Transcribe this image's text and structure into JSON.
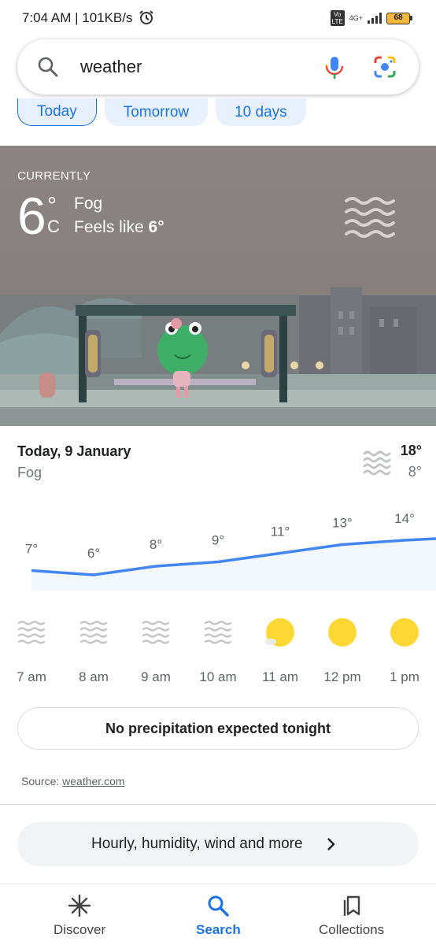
{
  "status_bar": {
    "time": "7:04 AM | 101KB/s",
    "network": "4G+",
    "battery": "68"
  },
  "search": {
    "query": "weather"
  },
  "tabs": [
    {
      "label": "Today",
      "active": true
    },
    {
      "label": "Tomorrow",
      "active": false
    },
    {
      "label": "10 days",
      "active": false
    }
  ],
  "current": {
    "heading": "CURRENTLY",
    "temp": "6",
    "deg": "°",
    "unit": "C",
    "condition": "Fog",
    "feels_like_label": "Feels like",
    "feels_like_value": "6°"
  },
  "today": {
    "date": "Today, 9 January",
    "condition": "Fog",
    "high": "18°",
    "low": "8°"
  },
  "hourly": {
    "times": [
      "7 am",
      "8 am",
      "9 am",
      "10 am",
      "11 am",
      "12 pm",
      "1 pm"
    ],
    "temps": [
      7,
      6,
      8,
      9,
      11,
      13,
      14
    ],
    "temp_labels": [
      "7°",
      "6°",
      "8°",
      "9°",
      "11°",
      "13°",
      "14°"
    ],
    "icons": [
      "fog-icon",
      "fog-icon",
      "fog-icon",
      "fog-icon",
      "partly-sunny-icon",
      "sunny-icon",
      "sunny-icon"
    ]
  },
  "notice": "No precipitation expected tonight",
  "source": {
    "label": "Source:",
    "link": "weather.com"
  },
  "more_button": "Hourly, humidity, wind and more",
  "bottom_nav": [
    {
      "label": "Discover",
      "active": false
    },
    {
      "label": "Search",
      "active": true
    },
    {
      "label": "Collections",
      "active": false
    }
  ],
  "colors": {
    "accent": "#1a73e8",
    "line": "#4285f4",
    "sun": "#fdd835",
    "hero_bg": "#8b8482"
  }
}
